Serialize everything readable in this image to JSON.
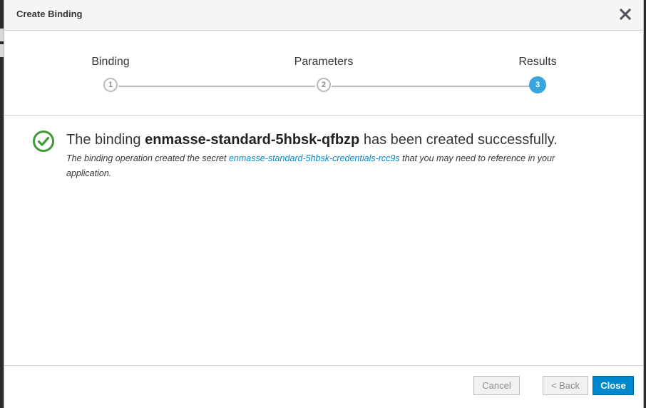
{
  "modal": {
    "title": "Create Binding"
  },
  "wizard": {
    "steps": [
      {
        "label": "Binding",
        "number": "1",
        "active": false
      },
      {
        "label": "Parameters",
        "number": "2",
        "active": false
      },
      {
        "label": "Results",
        "number": "3",
        "active": true
      }
    ]
  },
  "result": {
    "title_prefix": "The binding",
    "binding_name": "enmasse-standard-5hbsk-qfbzp",
    "title_suffix": "has been created successfully.",
    "desc_prefix": "The binding operation created the secret",
    "secret_name": "enmasse-standard-5hbsk-credentials-rcc9s",
    "desc_suffix": "that you may need to reference in your application."
  },
  "footer": {
    "cancel_label": "Cancel",
    "back_label": "< Back",
    "close_label": "Close"
  },
  "colors": {
    "primary": "#0088ce",
    "success": "#3f9c35",
    "step_active": "#39a5dc"
  }
}
